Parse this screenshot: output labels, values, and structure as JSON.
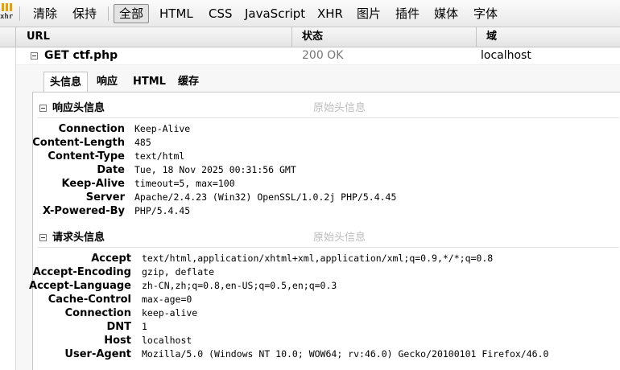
{
  "toolbar": {
    "logo_label": "xhr",
    "buttons": [
      {
        "label": "清除"
      },
      {
        "label": "保持"
      },
      {
        "label": "全部",
        "active": true
      },
      {
        "label": "HTML"
      },
      {
        "label": "CSS"
      },
      {
        "label": "JavaScript"
      },
      {
        "label": "XHR"
      },
      {
        "label": "图片"
      },
      {
        "label": "插件"
      },
      {
        "label": "媒体"
      },
      {
        "label": "字体"
      }
    ]
  },
  "columns": {
    "url": "URL",
    "status": "状态",
    "domain": "域"
  },
  "request": {
    "url": "GET ctf.php",
    "status": "200 OK",
    "domain": "localhost"
  },
  "tabs": [
    {
      "label": "头信息",
      "active": true
    },
    {
      "label": "响应"
    },
    {
      "label": "HTML"
    },
    {
      "label": "缓存"
    }
  ],
  "response_section": {
    "title": "响应头信息",
    "raw_label": "原始头信息",
    "headers": [
      {
        "name": "Connection",
        "value": "Keep-Alive"
      },
      {
        "name": "Content-Length",
        "value": "485"
      },
      {
        "name": "Content-Type",
        "value": "text/html"
      },
      {
        "name": "Date",
        "value": "Tue, 18 Nov 2025 00:31:56 GMT"
      },
      {
        "name": "Keep-Alive",
        "value": "timeout=5, max=100"
      },
      {
        "name": "Server",
        "value": "Apache/2.4.23 (Win32) OpenSSL/1.0.2j PHP/5.4.45"
      },
      {
        "name": "X-Powered-By",
        "value": "PHP/5.4.45"
      }
    ]
  },
  "request_section": {
    "title": "请求头信息",
    "raw_label": "原始头信息",
    "headers": [
      {
        "name": "Accept",
        "value": "text/html,application/xhtml+xml,application/xml;q=0.9,*/*;q=0.8"
      },
      {
        "name": "Accept-Encoding",
        "value": "gzip, deflate"
      },
      {
        "name": "Accept-Language",
        "value": "zh-CN,zh;q=0.8,en-US;q=0.5,en;q=0.3"
      },
      {
        "name": "Cache-Control",
        "value": "max-age=0"
      },
      {
        "name": "Connection",
        "value": "keep-alive"
      },
      {
        "name": "DNT",
        "value": "1"
      },
      {
        "name": "Host",
        "value": "localhost"
      },
      {
        "name": "User-Agent",
        "value": "Mozilla/5.0 (Windows NT 10.0; WOW64; rv:46.0) Gecko/20100101 Firefox/46.0"
      }
    ]
  }
}
